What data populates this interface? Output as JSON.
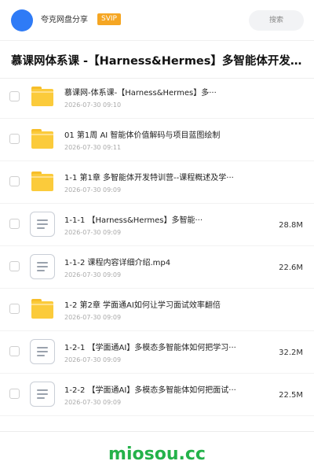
{
  "header": {
    "share_name": "夸克网盘分享",
    "badge": "SVIP",
    "search_label": "搜索",
    "avatar_color": "#2f7bf6"
  },
  "title": "慕课网体系课 -【Harness&Hermes】多智能体开发特···",
  "files": [
    {
      "type": "folder",
      "icon": "folder-icon",
      "name": "慕课网-体系课-【Harness&Hermes】多···",
      "date": "2026-07-30 09:10",
      "size": ""
    },
    {
      "type": "folder",
      "icon": "folder-icon",
      "name": "01 第1周 AI 智能体价值解码与项目蓝图绘制",
      "date": "2026-07-30 09:11",
      "size": ""
    },
    {
      "type": "folder",
      "icon": "folder-icon",
      "name": "1-1 第1章 多智能体开发特训营--课程概述及学···",
      "date": "2026-07-30 09:09",
      "size": ""
    },
    {
      "type": "file",
      "icon": "document-icon",
      "name": "1-1-1 【Harness&Hermes】多智能···",
      "date": "2026-07-30 09:09",
      "size": "28.8M"
    },
    {
      "type": "file",
      "icon": "document-icon",
      "name": "1-1-2 课程内容详细介绍.mp4",
      "date": "2026-07-30 09:09",
      "size": "22.6M"
    },
    {
      "type": "folder",
      "icon": "folder-icon",
      "name": "1-2 第2章 学面通AI如何让学习面试效率翻倍",
      "date": "2026-07-30 09:09",
      "size": ""
    },
    {
      "type": "file",
      "icon": "document-icon",
      "name": "1-2-1 【学面通AI】多模态多智能体如何把学习···",
      "date": "2026-07-30 09:09",
      "size": "32.2M"
    },
    {
      "type": "file",
      "icon": "document-icon",
      "name": "1-2-2 【学面通AI】多模态多智能体如何把面试···",
      "date": "2026-07-30 09:09",
      "size": "22.5M"
    }
  ],
  "watermark": "miosou.cc",
  "colors": {
    "folder": "#fbcb3b",
    "badge": "#f5a623",
    "watermark": "#24b24a"
  }
}
